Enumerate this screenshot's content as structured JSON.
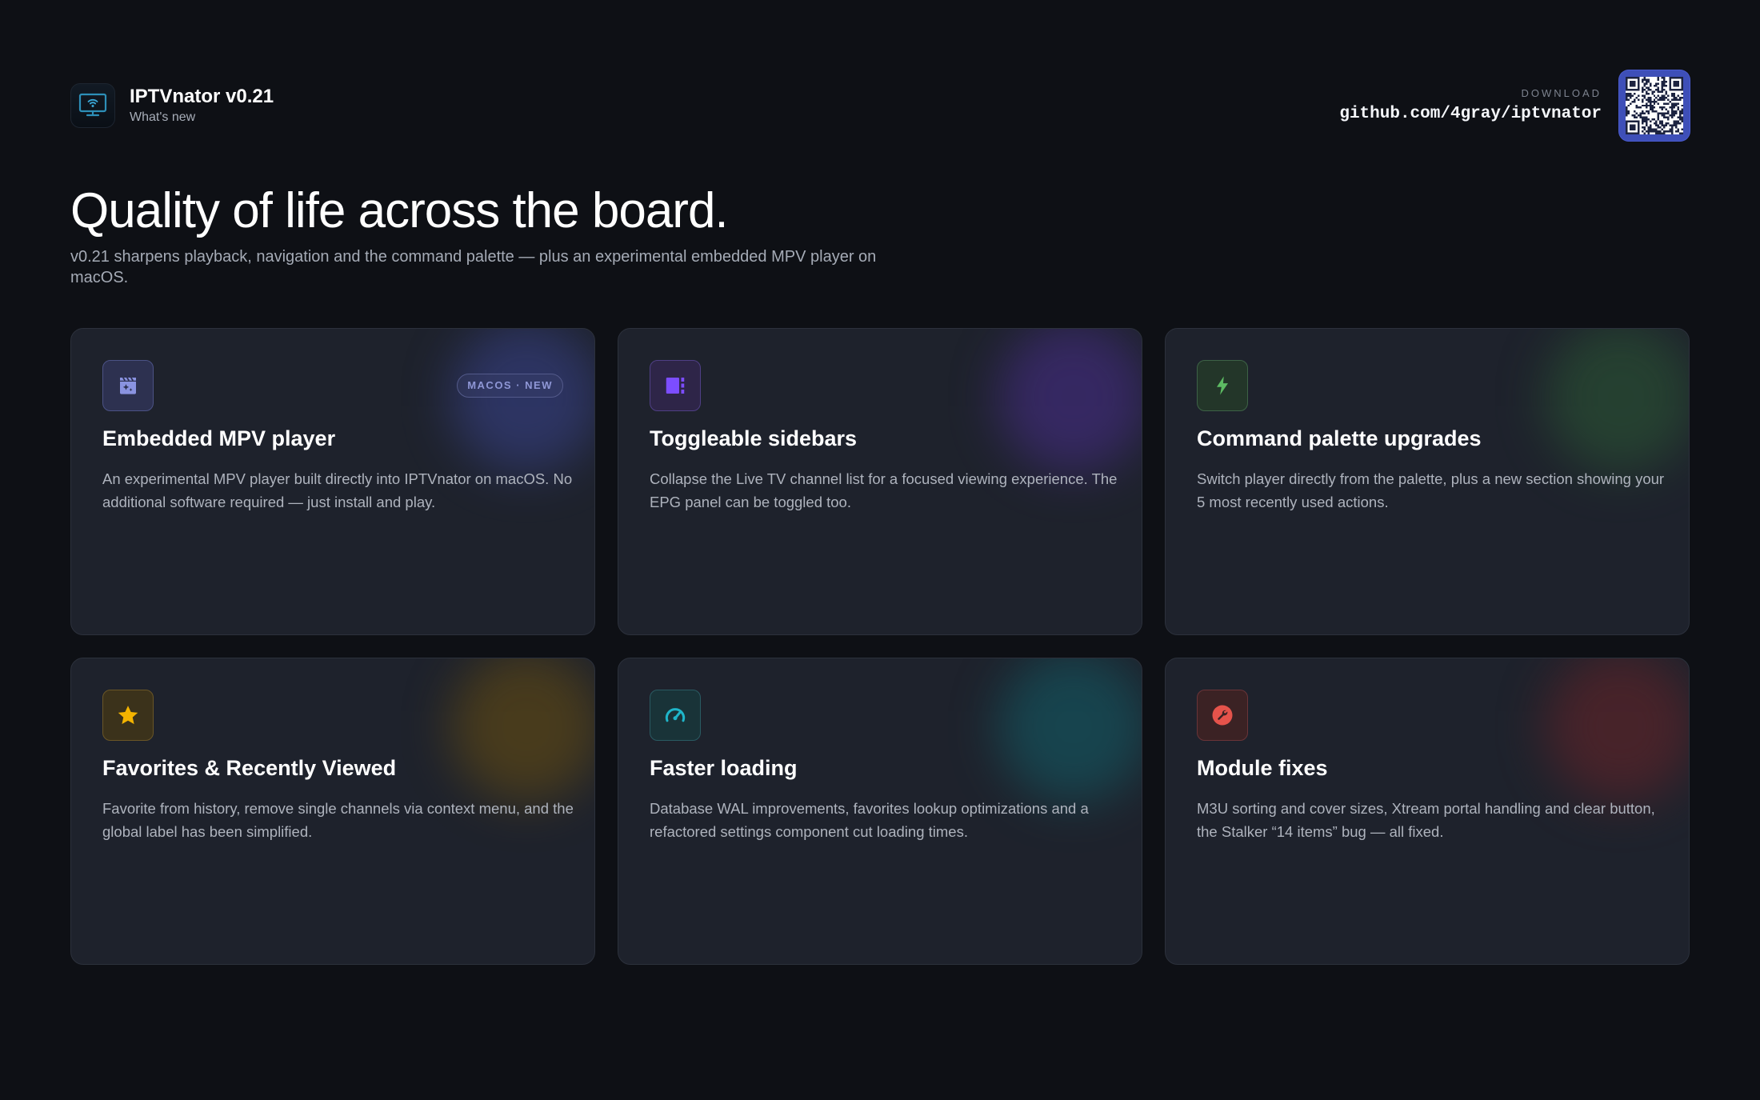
{
  "header": {
    "app_title": "IPTVnator v0.21",
    "subtitle": "What's new",
    "download_label": "DOWNLOAD",
    "download_url": "github.com/4gray/iptvnator",
    "logo_icon": "tv-icon",
    "qr_icon": "qr-code-icon"
  },
  "hero": {
    "title": "Quality of life across the board.",
    "subtitle": "v0.21 sharpens playback, navigation and the command palette — plus an experimental embedded MPV player on macOS."
  },
  "cards": [
    {
      "title": "Embedded MPV player",
      "description": "An experimental MPV player built directly into IPTVnator on macOS. No additional software required — just install and play.",
      "badge": "MACOS · NEW",
      "icon": "clapperboard-sparkle-icon",
      "accent": "#7c86d8",
      "icon_bg": "#2d3150",
      "icon_border": "#4b5285"
    },
    {
      "title": "Toggleable sidebars",
      "description": "Collapse the Live TV channel list for a focused viewing experience. The EPG panel can be toggled too.",
      "icon": "sidebar-toggle-icon",
      "accent": "#7c4dff",
      "icon_bg": "#2e2548",
      "icon_border": "#4f3f85"
    },
    {
      "title": "Command palette upgrades",
      "description": "Switch player directly from the palette, plus a new section showing your 5 most recently used actions.",
      "icon": "lightning-bolt-icon",
      "accent": "#5dbb63",
      "icon_bg": "#233629",
      "icon_border": "#3d6246"
    },
    {
      "title": "Favorites & Recently Viewed",
      "description": "Favorite from history, remove single channels via context menu, and the global label has been simplified.",
      "icon": "star-icon",
      "accent": "#f4b400",
      "icon_bg": "#3b321b",
      "icon_border": "#6a5626"
    },
    {
      "title": "Faster loading",
      "description": "Database WAL improvements, favorites lookup optimizations and a refactored settings component cut loading times.",
      "icon": "speedometer-icon",
      "accent": "#1fb5c9",
      "icon_bg": "#193338",
      "icon_border": "#2a5a62"
    },
    {
      "title": "Module fixes",
      "description": "M3U sorting and cover sizes, Xtream portal handling and clear button, the Stalker “14 items” bug — all fixed.",
      "icon": "wrench-icon",
      "accent": "#e5534b",
      "icon_bg": "#3b2224",
      "icon_border": "#6a3438"
    }
  ],
  "colors": {
    "background": "#0e1015",
    "card_background": "#1e222c",
    "qr_background": "#3e4fb8"
  }
}
